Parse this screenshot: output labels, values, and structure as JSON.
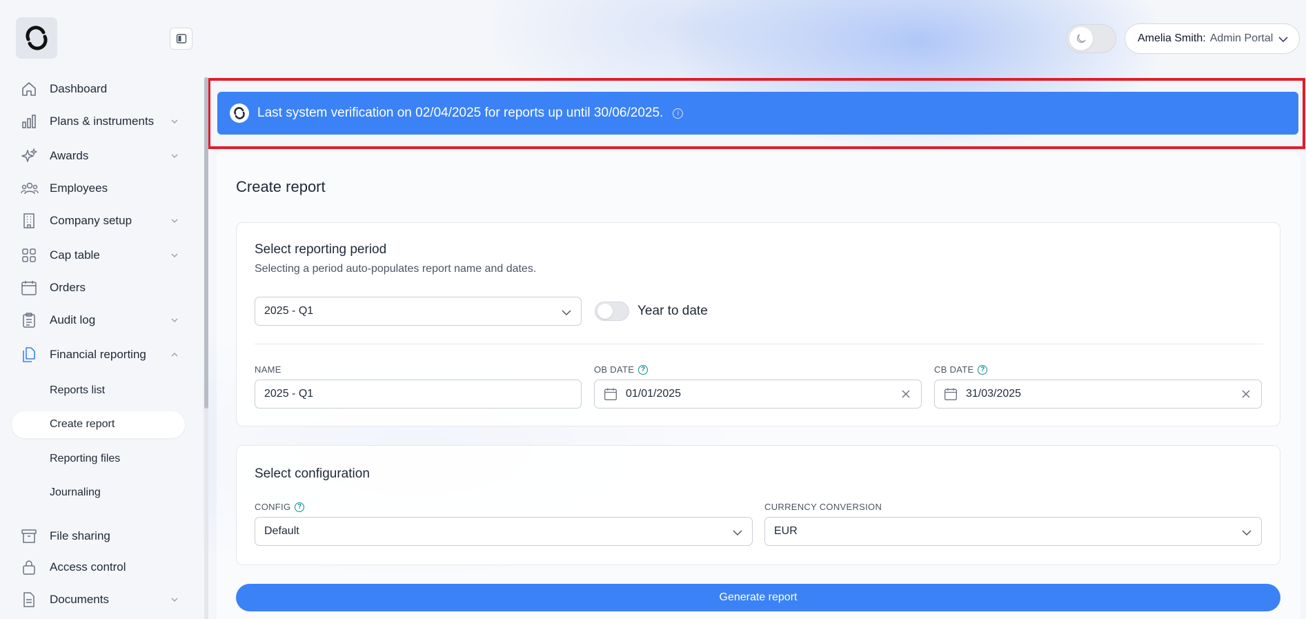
{
  "header": {
    "user_name": "Amelia Smith:",
    "user_role": "Admin Portal"
  },
  "sidebar": {
    "items": [
      {
        "label": "Dashboard",
        "icon": "home-icon"
      },
      {
        "label": "Plans & instruments",
        "icon": "bar-chart-icon"
      },
      {
        "label": "Awards",
        "icon": "sparkles-icon"
      },
      {
        "label": "Employees",
        "icon": "users-icon"
      },
      {
        "label": "Company setup",
        "icon": "building-icon"
      },
      {
        "label": "Cap table",
        "icon": "grid-icon"
      },
      {
        "label": "Orders",
        "icon": "calendar-icon"
      },
      {
        "label": "Audit log",
        "icon": "clipboard-icon"
      },
      {
        "label": "Financial reporting",
        "icon": "files-icon"
      },
      {
        "label": "File sharing",
        "icon": "archive-icon"
      },
      {
        "label": "Access control",
        "icon": "lock-icon"
      },
      {
        "label": "Documents",
        "icon": "document-icon"
      }
    ],
    "sub_items": [
      "Reports list",
      "Create report",
      "Reporting files",
      "Journaling"
    ]
  },
  "banner": {
    "text": "Last system verification on 02/04/2025 for reports up until 30/06/2025."
  },
  "page": {
    "title": "Create report"
  },
  "period": {
    "title": "Select reporting period",
    "subtitle": "Selecting a period auto-populates report name and dates.",
    "selected": "2025 - Q1",
    "ytd_label": "Year to date",
    "name_label": "NAME",
    "name_value": "2025 - Q1",
    "ob_label": "OB DATE",
    "ob_value": "01/01/2025",
    "cb_label": "CB DATE",
    "cb_value": "31/03/2025"
  },
  "config": {
    "title": "Select configuration",
    "config_label": "CONFIG",
    "config_value": "Default",
    "currency_label": "CURRENCY CONVERSION",
    "currency_value": "EUR"
  },
  "actions": {
    "generate_label": "Generate report"
  },
  "colors": {
    "accent": "#3b82f6",
    "highlight": "#e11d2a"
  }
}
